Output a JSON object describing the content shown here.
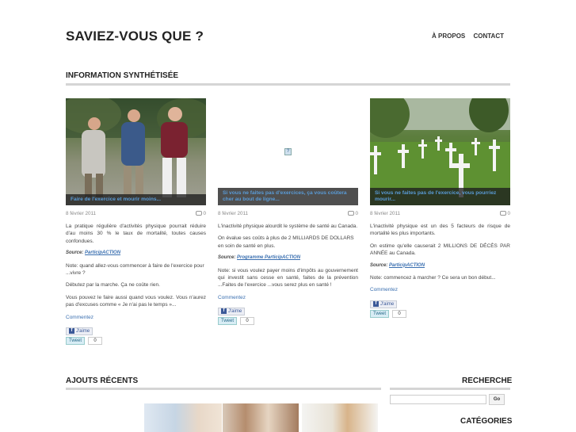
{
  "header": {
    "site_title": "SAVIEZ-VOUS QUE ?",
    "nav": [
      "À PROPOS",
      "CONTACT"
    ]
  },
  "section_title": "INFORMATION SYNTHÉTISÉE",
  "posts": [
    {
      "caption": "Faire de l'exercice et mourir moins...",
      "date": "8 février 2011",
      "comments": "0",
      "paragraphs": [
        "La pratique régulière d'activités physique pourrait réduire d'au moins 30 % le taux de mortalité, toutes causes confondues."
      ],
      "source_label": "Source:",
      "source_link": "ParticipACTION",
      "after_source": [
        "Note: quand allez-vous commencer à faire de l'exercice pour ...vivre ?",
        "Débutez par la marche. Ça ne coûte rien.",
        "Vous pouvez le faire aussi quand vous voulez. Vous n'aurez pas d'excuses comme « Je n'ai pas le temps »..."
      ],
      "comment_link": "Commentez",
      "like_label": "J'aime",
      "tweet_label": "Tweet",
      "tweet_count": "0"
    },
    {
      "caption": "Si vous ne faites pas d'exercices, ça vous coûtera cher au bout de ligne...",
      "date": "8 février 2011",
      "comments": "0",
      "paragraphs": [
        "L'inactivité physique alourdit le système de santé au Canada.",
        "On évalue ses coûts à plus de 2 MILLIARDS DE DOLLARS en soin de santé en plus."
      ],
      "source_label": "Source:",
      "source_link": "Programme ParticipACTION",
      "after_source": [
        "Note: si vous voulez payer moins d'impôts au gouvernement qui investit sans cesse en santé, faites de la prévention ...Faites de l'exercice ...vous serez plus en santé !"
      ],
      "comment_link": "Commentez",
      "like_label": "J'aime",
      "tweet_label": "Tweet",
      "tweet_count": "0"
    },
    {
      "caption": "Si vous ne faites pas de l'exercice, vous pourriez mourir...",
      "date": "8 février 2011",
      "comments": "0",
      "paragraphs": [
        "L'inactivité physique est un des 5 facteurs de risque de mortalité les plus importants.",
        "On estime qu'elle causerait 2 MILLIONS DE DÉCÈS PAR ANNÉE au Canada."
      ],
      "source_label": "Source:",
      "source_link": "ParticipACTION",
      "after_source": [
        "Note: commencez à marcher ? Ce sera un bon début..."
      ],
      "comment_link": "Commentez",
      "like_label": "J'aime",
      "tweet_label": "Tweet",
      "tweet_count": "0"
    }
  ],
  "recent": {
    "title": "AJOUTS RÉCENTS"
  },
  "sidebar": {
    "search_title": "RECHERCHE",
    "search_placeholder": "",
    "go_label": "Go",
    "categories_title": "CATÉGORIES"
  }
}
